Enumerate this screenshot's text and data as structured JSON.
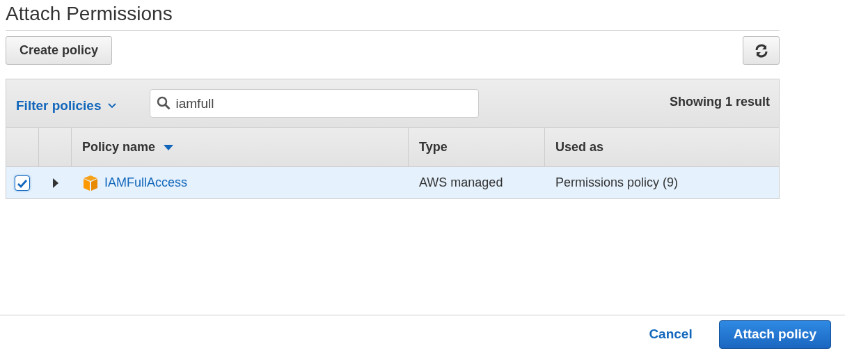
{
  "title": "Attach Permissions",
  "toolbar": {
    "create_button": "Create policy"
  },
  "filter": {
    "label": "Filter policies",
    "search_value": "iamfull",
    "result_count": "Showing 1 result"
  },
  "table": {
    "columns": [
      {
        "label": "Policy name",
        "sorted": true
      },
      {
        "label": "Type",
        "sorted": false
      },
      {
        "label": "Used as",
        "sorted": false
      }
    ],
    "rows": [
      {
        "selected": true,
        "expanded": false,
        "name": "IAMFullAccess",
        "type": "AWS managed",
        "used_as": "Permissions policy (9)"
      }
    ]
  },
  "footer": {
    "cancel": "Cancel",
    "primary": "Attach policy"
  }
}
